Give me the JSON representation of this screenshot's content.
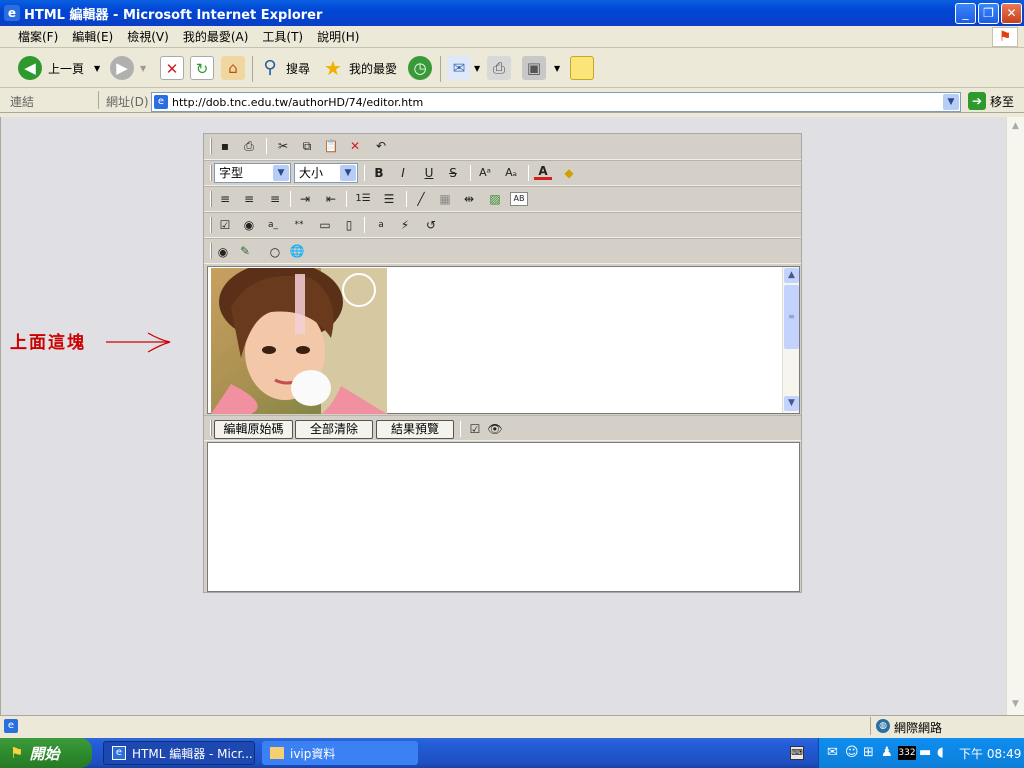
{
  "window": {
    "title": "HTML 編輯器 - Microsoft Internet Explorer",
    "minimize_glyph": "_",
    "restore_glyph": "❐",
    "close_glyph": "✕"
  },
  "menu": [
    "檔案(F)",
    "編輯(E)",
    "檢視(V)",
    "我的最愛(A)",
    "工具(T)",
    "說明(H)"
  ],
  "toolbar": {
    "back_label": "上一頁",
    "search_label": "搜尋",
    "favorites_label": "我的最愛"
  },
  "address": {
    "links_label": "連結",
    "address_label": "網址(D)",
    "url": "http://dob.tnc.edu.tw/authorHD/74/editor.htm",
    "go_label": "移至"
  },
  "annotation": {
    "text": "上面這塊",
    "color": "#cc0000"
  },
  "editor": {
    "font_select": "字型",
    "size_select": "大小",
    "edit_source_button": "編輯原始碼",
    "clear_all_button": "全部清除",
    "preview_button": "結果預覽"
  },
  "statusbar": {
    "zone": "網際網路"
  },
  "taskbar": {
    "start_label": "開始",
    "task1": "HTML 編輯器 - Micr...",
    "task2": "ivip資料",
    "tray_number": "332",
    "clock": "下午 08:49"
  },
  "colors": {
    "titlebar": "#0a3fc6",
    "taskbar": "#245edb",
    "content_bg": "#e0dfe3",
    "editor_bg": "#d4d0c8"
  }
}
